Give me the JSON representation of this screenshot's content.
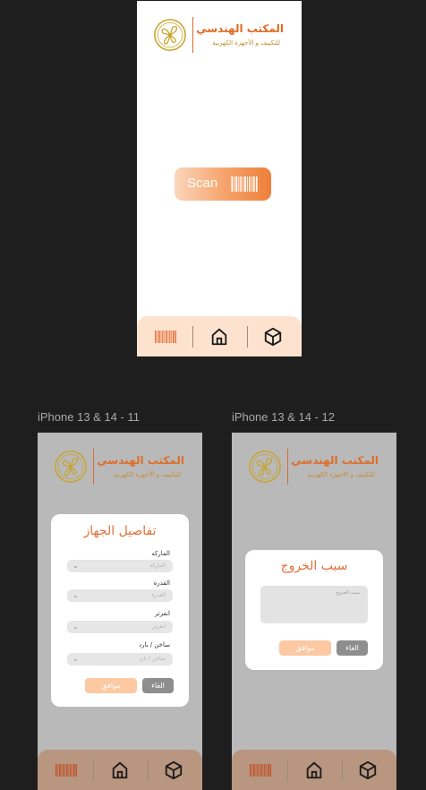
{
  "colors": {
    "accent": "#e3703a",
    "canvas": "#1e1e1e",
    "nav_bg": "#fde3cf"
  },
  "logo": {
    "title": "المكتب الهندسي",
    "subtitle": "للتكييف و الأجهزة الكهربية"
  },
  "scan": {
    "label": "Scan"
  },
  "nav": {
    "icons": [
      "barcode-icon",
      "home-icon",
      "box-icon"
    ]
  },
  "frames": {
    "f2_label": "iPhone 13 & 14 - 11",
    "f3_label": "iPhone 13 & 14 - 12"
  },
  "device_modal": {
    "title": "تفاصيل الجهاز",
    "fields": [
      {
        "label": "الماركه",
        "placeholder": "الماركه"
      },
      {
        "label": "القدرة",
        "placeholder": "القدرة"
      },
      {
        "label": "انفرتر",
        "placeholder": "انفرتر"
      },
      {
        "label": "ساخن / بارد",
        "placeholder": "ساخن / بارد"
      }
    ],
    "ok": "موافق",
    "cancel": "الغاء"
  },
  "exit_modal": {
    "title": "سبب الخروج",
    "placeholder": "سبب الخروج",
    "ok": "موافق",
    "cancel": "الغاء"
  }
}
